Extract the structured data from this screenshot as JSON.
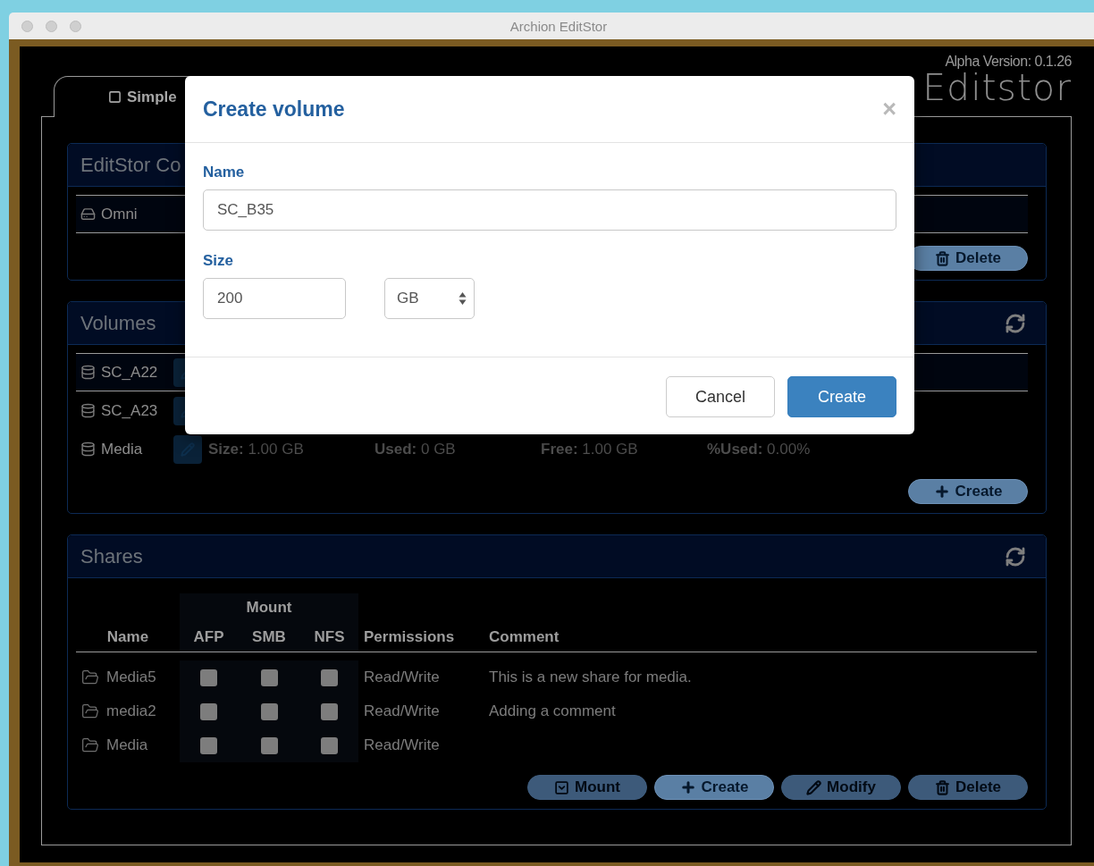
{
  "window": {
    "title": "Archion EditStor"
  },
  "header": {
    "version": "Alpha Version: 0.1.26",
    "logo": "Editstor"
  },
  "tabs": [
    {
      "label": "Simple",
      "selected": true
    }
  ],
  "controllers_panel": {
    "title": "EditStor Co",
    "items": [
      {
        "name": "Omni",
        "selected": true
      }
    ],
    "buttons": [
      {
        "label": "Delete",
        "kind": "delete",
        "disabled": false
      }
    ]
  },
  "volumes_panel": {
    "title": "Volumes",
    "items": [
      {
        "name": "SC_A22",
        "selected": true
      },
      {
        "name": "SC_A23",
        "selected": false
      },
      {
        "name": "Media",
        "selected": false,
        "details": [
          {
            "label": "Size:",
            "value": "1.00 GB"
          },
          {
            "label": "Used:",
            "value": "0 GB"
          },
          {
            "label": "Free:",
            "value": "1.00 GB"
          },
          {
            "label": "%Used:",
            "value": "0.00%"
          }
        ]
      }
    ],
    "buttons": [
      {
        "label": "Create",
        "kind": "create",
        "disabled": false
      }
    ]
  },
  "shares_panel": {
    "title": "Shares",
    "group_header": "Mount",
    "columns": [
      "Name",
      "AFP",
      "SMB",
      "NFS",
      "Permissions",
      "Comment"
    ],
    "rows": [
      {
        "name": "Media5",
        "afp": false,
        "smb": false,
        "nfs": false,
        "permissions": "Read/Write",
        "comment": "This is a new share for media."
      },
      {
        "name": "media2",
        "afp": false,
        "smb": false,
        "nfs": false,
        "permissions": "Read/Write",
        "comment": "Adding a comment"
      },
      {
        "name": "Media",
        "afp": false,
        "smb": false,
        "nfs": false,
        "permissions": "Read/Write"
      }
    ],
    "buttons": [
      {
        "label": "Mount",
        "kind": "mount",
        "disabled": true
      },
      {
        "label": "Create",
        "kind": "create",
        "disabled": false
      },
      {
        "label": "Modify",
        "kind": "modify",
        "disabled": true
      },
      {
        "label": "Delete",
        "kind": "delete",
        "disabled": true
      }
    ]
  },
  "dialog": {
    "title": "Create volume",
    "close": "×",
    "fields": [
      {
        "label": "Name",
        "value": "SC_B35"
      }
    ],
    "size_label": "Size",
    "size_value": "200",
    "unit": "GB",
    "buttons": [
      {
        "label": "Cancel",
        "primary": false
      },
      {
        "label": "Create",
        "primary": true
      }
    ]
  }
}
